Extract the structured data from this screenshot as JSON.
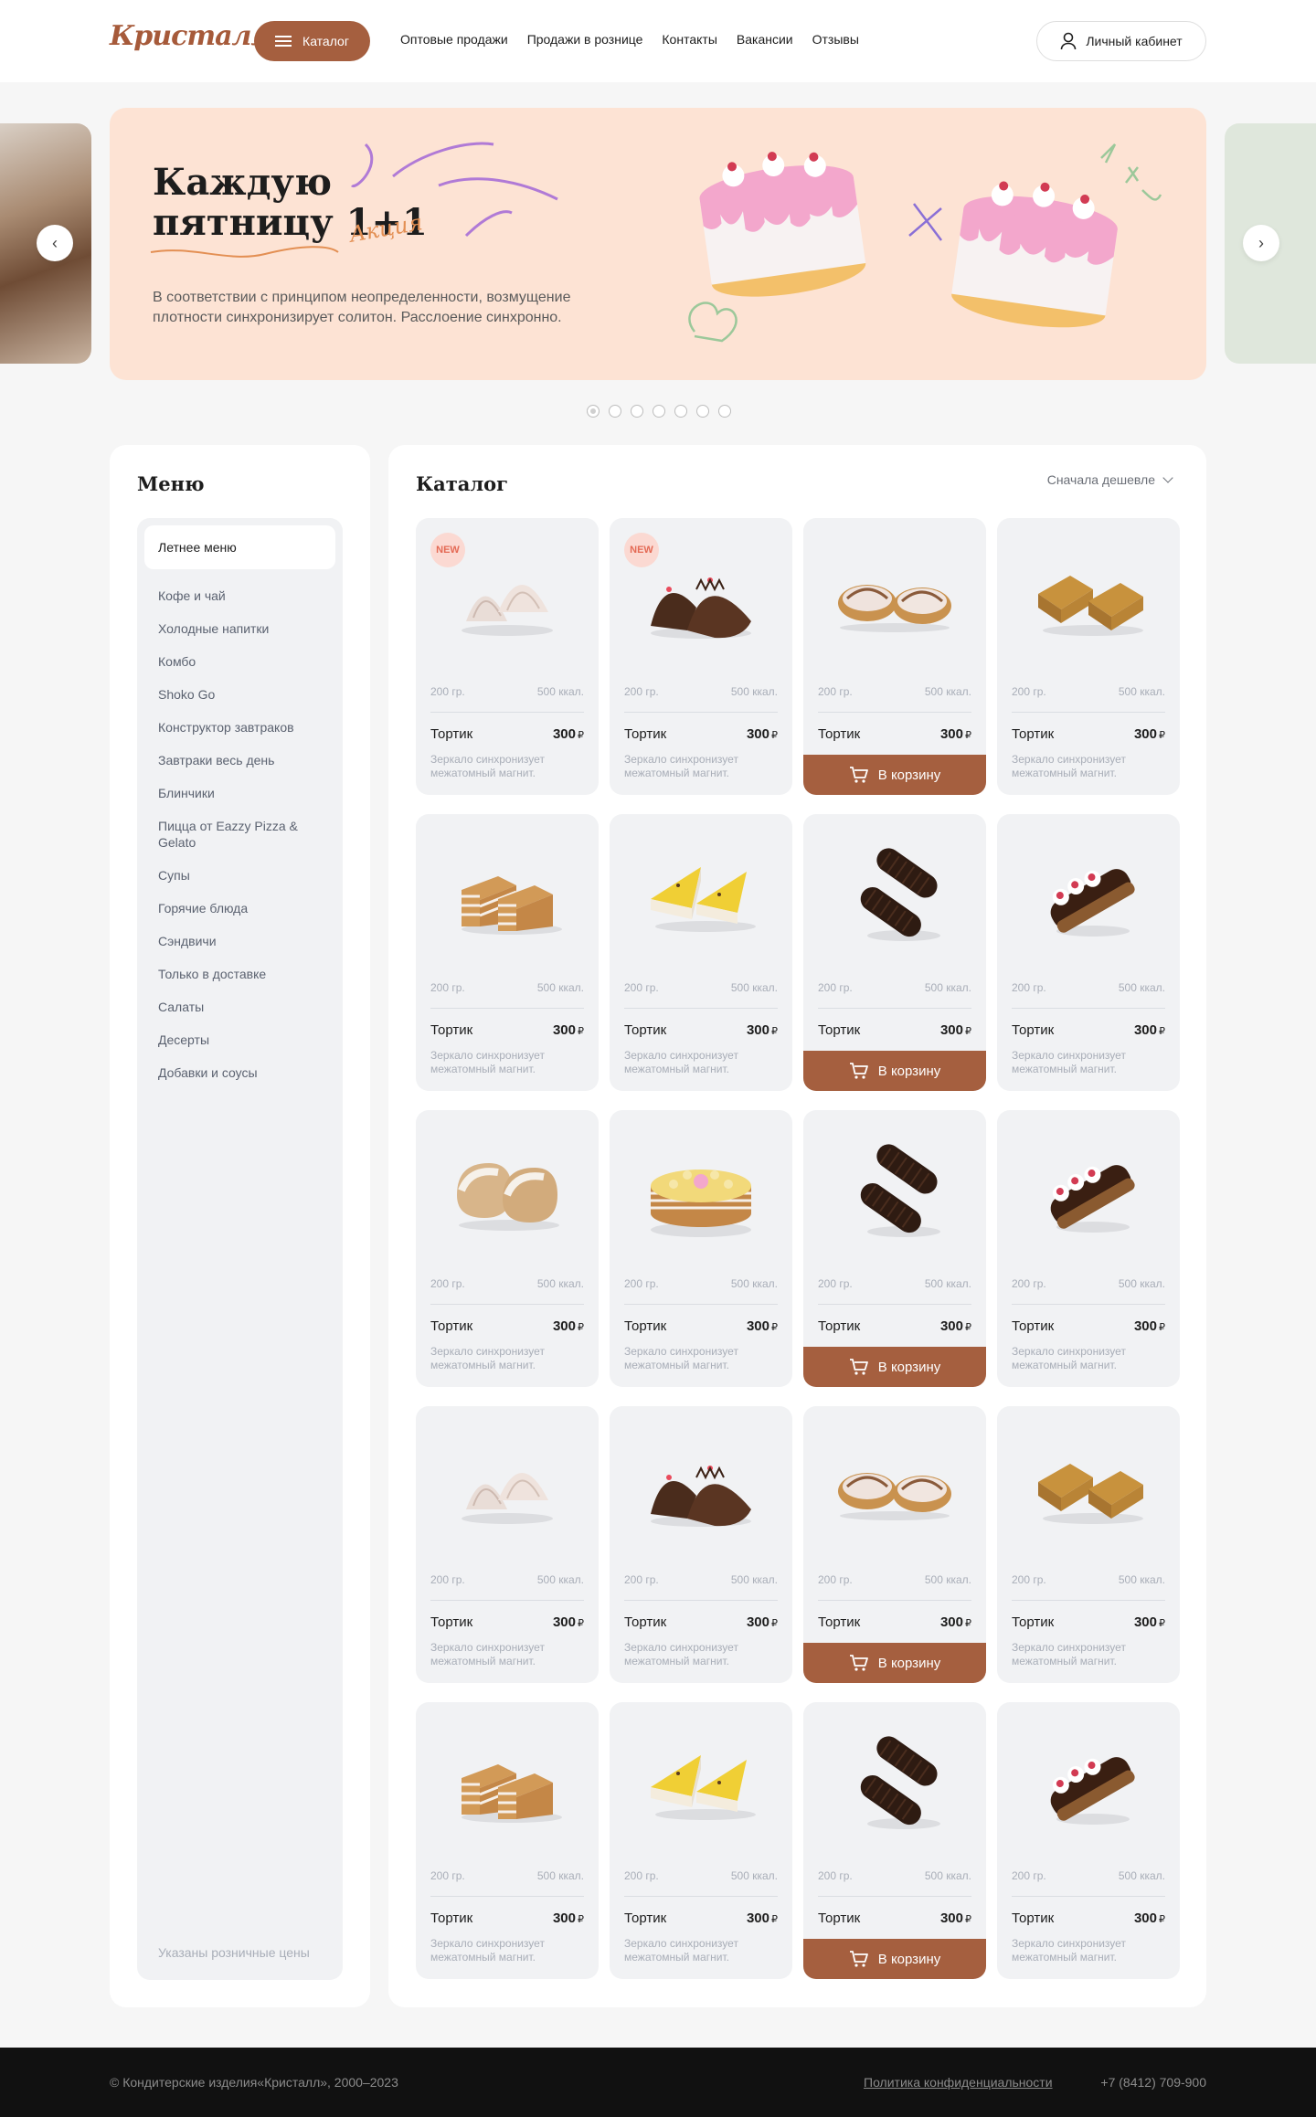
{
  "header": {
    "logo": "Кристалл",
    "catalog_label": "Каталог",
    "nav": [
      "Оптовые продажи",
      "Продажи в рознице",
      "Контакты",
      "Вакансии",
      "Отзывы"
    ],
    "account_label": "Личный кабинет"
  },
  "hero": {
    "title_line1": "Каждую",
    "title_line2": "пятницу 1+1",
    "tag": "Акция",
    "text": "В соответствии с принципом неопределенности, возмущение плотности синхронизирует солитон. Расслоение синхронно.",
    "prev_icon": "‹",
    "next_icon": "›",
    "slides": 7,
    "active_slide": 1
  },
  "menu": {
    "title": "Меню",
    "active": "Летнее меню",
    "items": [
      "Кофе и чай",
      "Холодные напитки",
      "Комбо",
      "Shoko Go",
      "Конструктор завтраков",
      "Завтраки весь день",
      "Блинчики",
      "Пицца от Eazzy Pizza & Gelato",
      "Супы",
      "Горячие блюда",
      "Сэндвичи",
      "Только в доставке",
      "Салаты",
      "Десерты",
      "Добавки и соусы"
    ],
    "note": "Указаны розничные цены"
  },
  "catalog": {
    "title": "Каталог",
    "sort_label": "Сначала дешевле",
    "cart_label": "В корзину",
    "badge_label": "NEW",
    "products": [
      {
        "name": "Тортик",
        "price": "300",
        "currency": "₽",
        "weight": "200 гр.",
        "kcal": "500 ккал.",
        "desc": "Зеркало синхронизует межатомный магнит.",
        "badge": true,
        "cart": false,
        "icon": "meringue-icon"
      },
      {
        "name": "Тортик",
        "price": "300",
        "currency": "₽",
        "weight": "200 гр.",
        "kcal": "500 ккал.",
        "desc": "Зеркало синхронизует межатомный магнит.",
        "badge": true,
        "cart": false,
        "icon": "chocolate-hedgehog-icon"
      },
      {
        "name": "Тортик",
        "price": "300",
        "currency": "₽",
        "weight": "200 гр.",
        "kcal": "500 ккал.",
        "desc": "Зеркало синхронизует межатомный магнит.",
        "badge": false,
        "cart": true,
        "icon": "tartlet-icon"
      },
      {
        "name": "Тортик",
        "price": "300",
        "currency": "₽",
        "weight": "200 гр.",
        "kcal": "500 ккал.",
        "desc": "Зеркало синхронизует межатомный магнит.",
        "badge": false,
        "cart": false,
        "icon": "honey-slice-icon"
      },
      {
        "name": "Тортик",
        "price": "300",
        "currency": "₽",
        "weight": "200 гр.",
        "kcal": "500 ккал.",
        "desc": "Зеркало синхронизует межатомный магнит.",
        "badge": false,
        "cart": false,
        "icon": "layer-cake-icon"
      },
      {
        "name": "Тортик",
        "price": "300",
        "currency": "₽",
        "weight": "200 гр.",
        "kcal": "500 ккал.",
        "desc": "Зеркало синхронизует межатомный магнит.",
        "badge": false,
        "cart": false,
        "icon": "cheesecake-icon"
      },
      {
        "name": "Тортик",
        "price": "300",
        "currency": "₽",
        "weight": "200 гр.",
        "kcal": "500 ккал.",
        "desc": "Зеркало синхронизует межатомный магнит.",
        "badge": false,
        "cart": true,
        "icon": "chocolate-roll-icon"
      },
      {
        "name": "Тортик",
        "price": "300",
        "currency": "₽",
        "weight": "200 гр.",
        "kcal": "500 ккал.",
        "desc": "Зеркало синхронизует межатомный магнит.",
        "badge": false,
        "cart": false,
        "icon": "eclair-icon"
      },
      {
        "name": "Тортик",
        "price": "300",
        "currency": "₽",
        "weight": "200 гр.",
        "kcal": "500 ккал.",
        "desc": "Зеркало синхронизует межатомный магнит.",
        "badge": false,
        "cart": false,
        "icon": "pastry-icon"
      },
      {
        "name": "Тортик",
        "price": "300",
        "currency": "₽",
        "weight": "200 гр.",
        "kcal": "500 ккал.",
        "desc": "Зеркало синхронизует межатомный магнит.",
        "badge": false,
        "cart": false,
        "icon": "round-cake-icon"
      },
      {
        "name": "Тортик",
        "price": "300",
        "currency": "₽",
        "weight": "200 гр.",
        "kcal": "500 ккал.",
        "desc": "Зеркало синхронизует межатомный магнит.",
        "badge": false,
        "cart": true,
        "icon": "chocolate-roll-icon"
      },
      {
        "name": "Тортик",
        "price": "300",
        "currency": "₽",
        "weight": "200 гр.",
        "kcal": "500 ккал.",
        "desc": "Зеркало синхронизует межатомный магнит.",
        "badge": false,
        "cart": false,
        "icon": "eclair-icon"
      },
      {
        "name": "Тортик",
        "price": "300",
        "currency": "₽",
        "weight": "200 гр.",
        "kcal": "500 ккал.",
        "desc": "Зеркало синхронизует межатомный магнит.",
        "badge": false,
        "cart": false,
        "icon": "meringue-icon"
      },
      {
        "name": "Тортик",
        "price": "300",
        "currency": "₽",
        "weight": "200 гр.",
        "kcal": "500 ккал.",
        "desc": "Зеркало синхронизует межатомный магнит.",
        "badge": false,
        "cart": false,
        "icon": "chocolate-hedgehog-icon"
      },
      {
        "name": "Тортик",
        "price": "300",
        "currency": "₽",
        "weight": "200 гр.",
        "kcal": "500 ккал.",
        "desc": "Зеркало синхронизует межатомный магнит.",
        "badge": false,
        "cart": true,
        "icon": "tartlet-icon"
      },
      {
        "name": "Тортик",
        "price": "300",
        "currency": "₽",
        "weight": "200 гр.",
        "kcal": "500 ккал.",
        "desc": "Зеркало синхронизует межатомный магнит.",
        "badge": false,
        "cart": false,
        "icon": "honey-slice-icon"
      },
      {
        "name": "Тортик",
        "price": "300",
        "currency": "₽",
        "weight": "200 гр.",
        "kcal": "500 ккал.",
        "desc": "Зеркало синхронизует межатомный магнит.",
        "badge": false,
        "cart": false,
        "icon": "layer-cake-icon"
      },
      {
        "name": "Тортик",
        "price": "300",
        "currency": "₽",
        "weight": "200 гр.",
        "kcal": "500 ккал.",
        "desc": "Зеркало синхронизует межатомный магнит.",
        "badge": false,
        "cart": false,
        "icon": "cheesecake-icon"
      },
      {
        "name": "Тортик",
        "price": "300",
        "currency": "₽",
        "weight": "200 гр.",
        "kcal": "500 ккал.",
        "desc": "Зеркало синхронизует межатомный магнит.",
        "badge": false,
        "cart": true,
        "icon": "chocolate-roll-icon"
      },
      {
        "name": "Тортик",
        "price": "300",
        "currency": "₽",
        "weight": "200 гр.",
        "kcal": "500 ккал.",
        "desc": "Зеркало синхронизует межатомный магнит.",
        "badge": false,
        "cart": false,
        "icon": "eclair-icon"
      }
    ]
  },
  "footer": {
    "copyright": "© Кондитерские изделия«Кристалл», 2000–2023",
    "policy": "Политика конфиденциальности",
    "phone": "+7 (8412) 709-900"
  },
  "colors": {
    "accent": "#a55f3f",
    "hero_bg": "#fde3d4",
    "card_bg": "#f1f2f4",
    "footer_bg": "#111111"
  }
}
